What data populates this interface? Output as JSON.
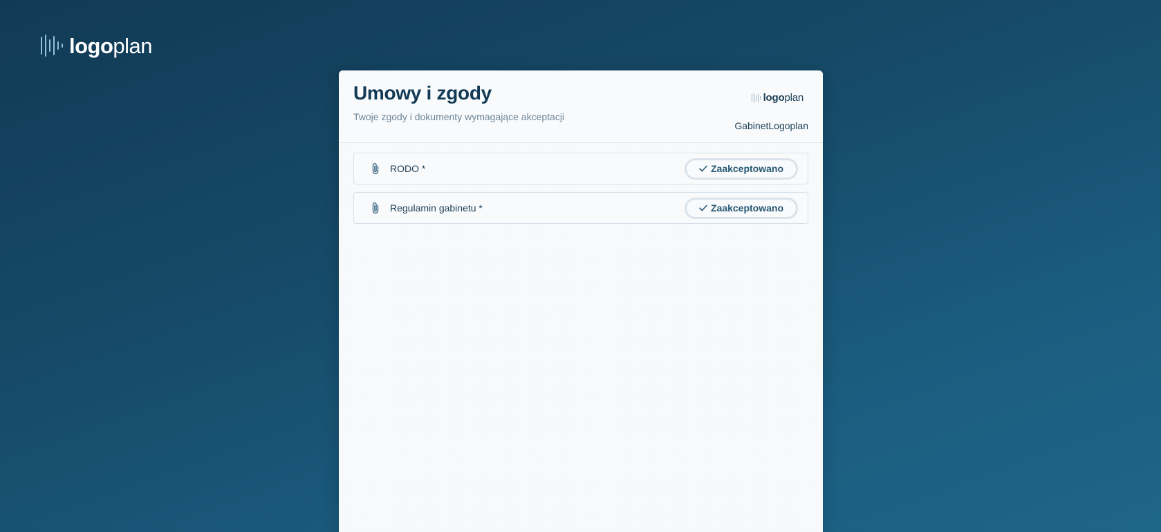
{
  "brand": {
    "bold": "logo",
    "light": "plan"
  },
  "header": {
    "title": "Umowy i zgody",
    "subtitle": "Twoje zgody i dokumenty wymagające akceptacji",
    "org_name": "GabinetLogoplan"
  },
  "consents": [
    {
      "label": "RODO *",
      "status": "Zaakceptowano",
      "icon": "paperclip-icon"
    },
    {
      "label": "Regulamin gabinetu *",
      "status": "Zaakceptowano",
      "icon": "paperclip-icon"
    }
  ],
  "colors": {
    "background_start": "#113a55",
    "background_end": "#1e6688",
    "card": "#f7f9fb",
    "title": "#123a55",
    "accent": "#275872"
  }
}
